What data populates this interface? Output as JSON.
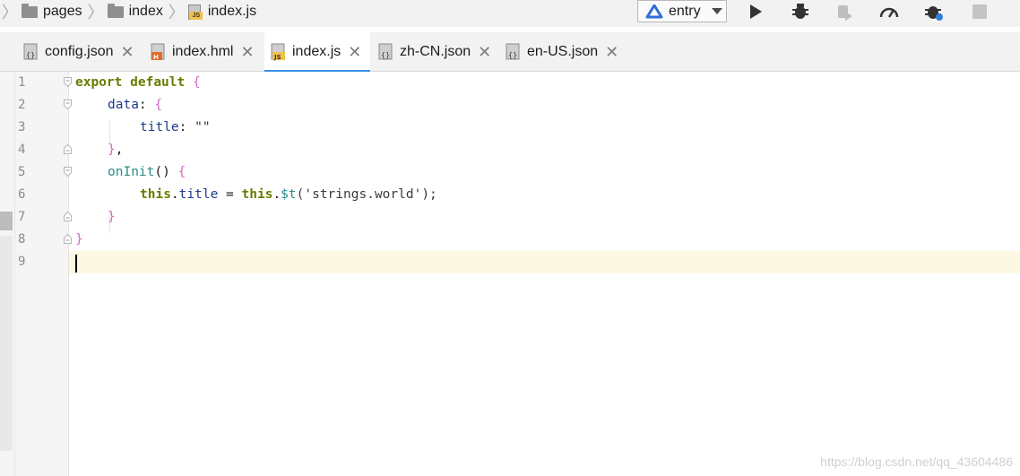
{
  "breadcrumb": [
    "pages",
    "index",
    "index.js"
  ],
  "run_config": {
    "label": "entry"
  },
  "toolbar_icons": [
    "run-icon",
    "debug-icon",
    "attach-icon",
    "profiler-icon",
    "debug-settings-icon",
    "stop-icon"
  ],
  "tabs": [
    {
      "label": "config.json",
      "icon": "json-file-icon",
      "active": false
    },
    {
      "label": "index.hml",
      "icon": "hml-file-icon",
      "active": false
    },
    {
      "label": "index.js",
      "icon": "js-file-icon",
      "active": true
    },
    {
      "label": "zh-CN.json",
      "icon": "json-file-icon",
      "active": false
    },
    {
      "label": "en-US.json",
      "icon": "json-file-icon",
      "active": false
    }
  ],
  "editor": {
    "line_numbers": [
      "1",
      "2",
      "3",
      "4",
      "5",
      "6",
      "7",
      "8",
      "9"
    ],
    "current_line": 9,
    "code": {
      "l1_kw1": "export",
      "l1_kw2": "default",
      "l1_brace": "{",
      "l2_prop": "data",
      "l2_colon": ": ",
      "l2_brace": "{",
      "l3_prop": "title",
      "l3_colon": ": ",
      "l3_str": "\"\"",
      "l4_brace": "}",
      "l4_comma": ",",
      "l5_fn": "onInit",
      "l5_parens": "() ",
      "l5_brace": "{",
      "l6_this1": "this",
      "l6_dot1": ".",
      "l6_prop": "title",
      "l6_eq": " = ",
      "l6_this2": "this",
      "l6_dot2": ".",
      "l6_fn": "$t",
      "l6_args": "('strings.world');",
      "l7_brace": "}",
      "l8_brace": "}"
    }
  },
  "watermark": "https://blog.csdn.net/qq_43604486"
}
